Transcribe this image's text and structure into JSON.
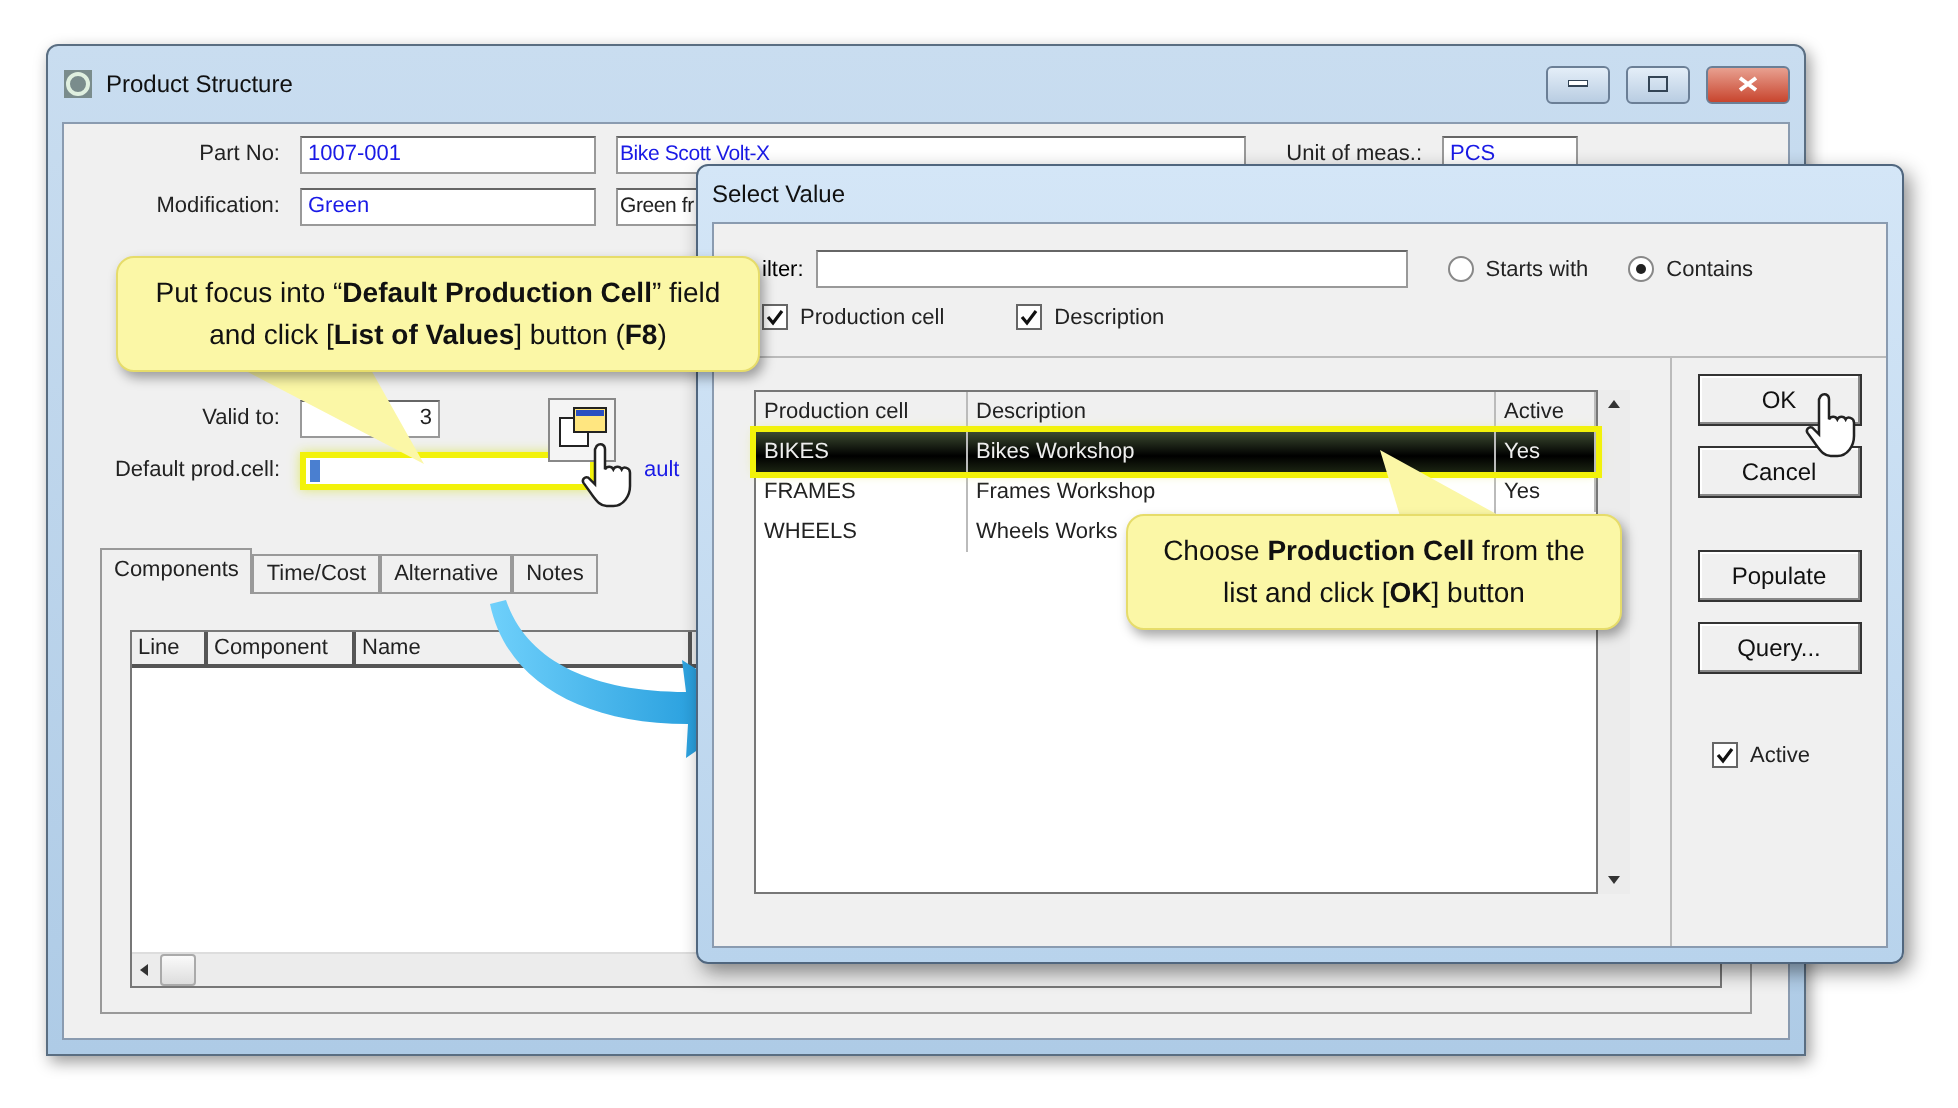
{
  "main_window": {
    "title": "Product Structure",
    "fields": [
      {
        "label": "Part No:",
        "value": "1007-001",
        "description": "Bike Scott Volt-X"
      },
      {
        "label": "Modification:",
        "value": "Green",
        "description": "Green fr"
      }
    ],
    "unit": {
      "label": "Unit of meas.:",
      "value": "PCS"
    },
    "valid_to": {
      "label": "Valid to:",
      "value": "3"
    },
    "default_cell": {
      "label": "Default prod.cell:",
      "link": "ault"
    },
    "tabs": [
      {
        "label": "Components",
        "selected": true
      },
      {
        "label": "Time/Cost",
        "selected": false
      },
      {
        "label": "Alternative",
        "selected": false
      },
      {
        "label": "Notes",
        "selected": false
      }
    ],
    "grid_columns": [
      "Line",
      "Component",
      "Name"
    ]
  },
  "dialog": {
    "title": "Select Value",
    "filter_label": "ilter:",
    "match": [
      {
        "label": "Starts with",
        "selected": false
      },
      {
        "label": "Contains",
        "selected": true
      }
    ],
    "search_in": [
      {
        "label": "Production cell",
        "checked": true
      },
      {
        "label": "Description",
        "checked": true
      }
    ],
    "columns": [
      "Production cell",
      "Description",
      "Active"
    ],
    "rows": [
      {
        "cell": "BIKES",
        "description": "Bikes Workshop",
        "active": "Yes",
        "selected": true
      },
      {
        "cell": "FRAMES",
        "description": "Frames Workshop",
        "active": "Yes",
        "selected": false
      },
      {
        "cell": "WHEELS",
        "description": "Wheels Works",
        "selected": false
      }
    ],
    "buttons": [
      "OK",
      "Cancel",
      "Populate",
      "Query..."
    ],
    "active": {
      "label": "Active",
      "checked": true
    }
  },
  "callouts": [
    {
      "text": "Put focus into “**Default Production Cell**” field and click [**List of Values**] button (**F8**)"
    },
    {
      "text": "Choose **Production Cell** from the list and click [**OK**] button"
    }
  ]
}
